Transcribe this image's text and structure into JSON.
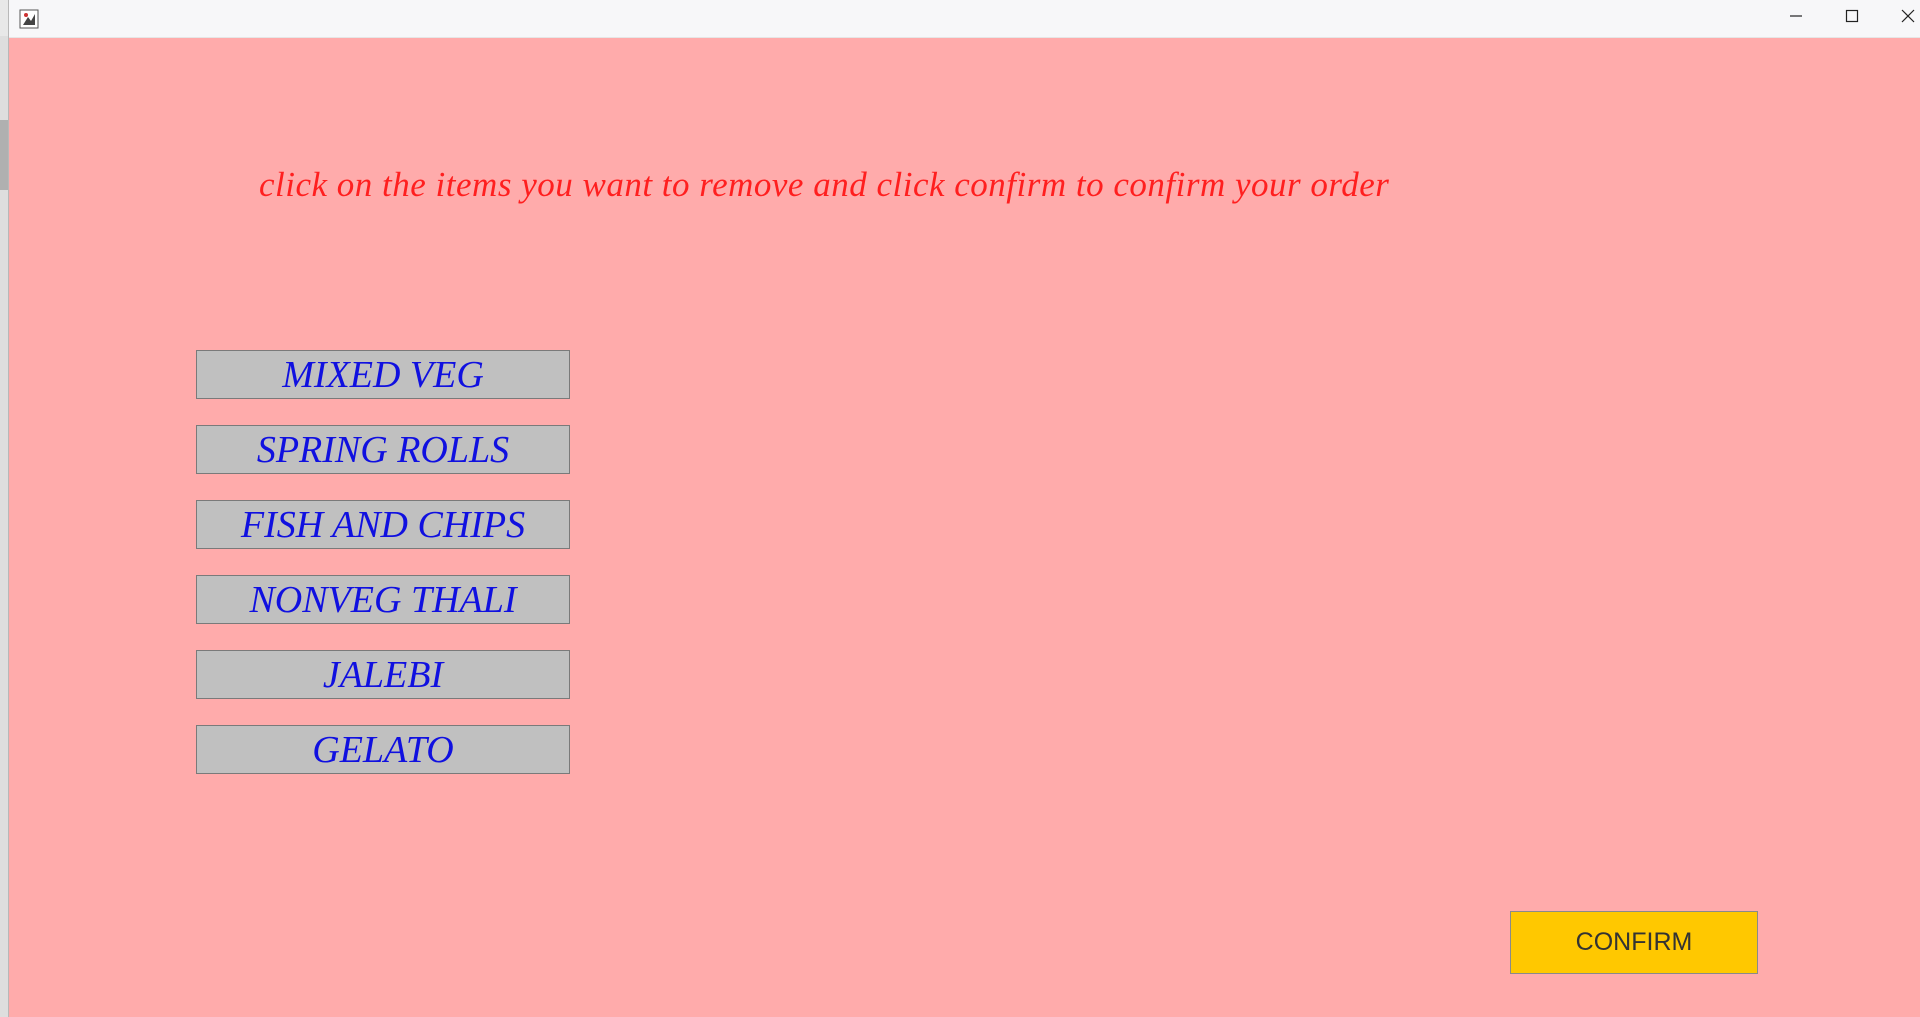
{
  "window": {
    "icon": "java-app-icon",
    "controls": {
      "minimize": "minimize-icon",
      "maximize": "maximize-icon",
      "close": "close-icon"
    }
  },
  "instruction": "click on the items you want to remove and click confirm to confirm your order",
  "items": [
    {
      "label": "MIXED VEG"
    },
    {
      "label": "SPRING ROLLS"
    },
    {
      "label": "FISH AND CHIPS"
    },
    {
      "label": "NONVEG THALI"
    },
    {
      "label": "JALEBI"
    },
    {
      "label": "GELATO"
    }
  ],
  "confirm_label": "CONFIRM",
  "colors": {
    "background": "#ffabab",
    "instruction_text": "#ff1f1f",
    "item_button": "#c0c0c0",
    "item_text": "#1010e0",
    "confirm_button": "#ffc800"
  }
}
